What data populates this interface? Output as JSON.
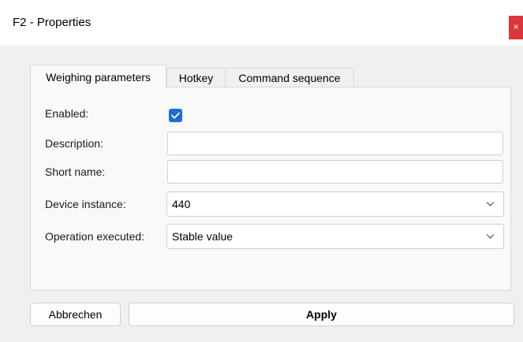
{
  "window": {
    "title": "F2 - Properties",
    "close_glyph": "×"
  },
  "tabs": [
    {
      "label": "Weighing parameters",
      "active": true
    },
    {
      "label": "Hotkey",
      "active": false
    },
    {
      "label": "Command sequence",
      "active": false
    }
  ],
  "form": {
    "enabled_label": "Enabled:",
    "enabled_checked": true,
    "description_label": "Description:",
    "description_value": "",
    "short_name_label": "Short name:",
    "short_name_value": "",
    "device_instance_label": "Device instance:",
    "device_instance_value": "440",
    "operation_label": "Operation executed:",
    "operation_value": "Stable value"
  },
  "buttons": {
    "cancel": "Abbrechen",
    "apply": "Apply"
  },
  "colors": {
    "accent": "#1a6ed1",
    "close": "#d9363e"
  }
}
